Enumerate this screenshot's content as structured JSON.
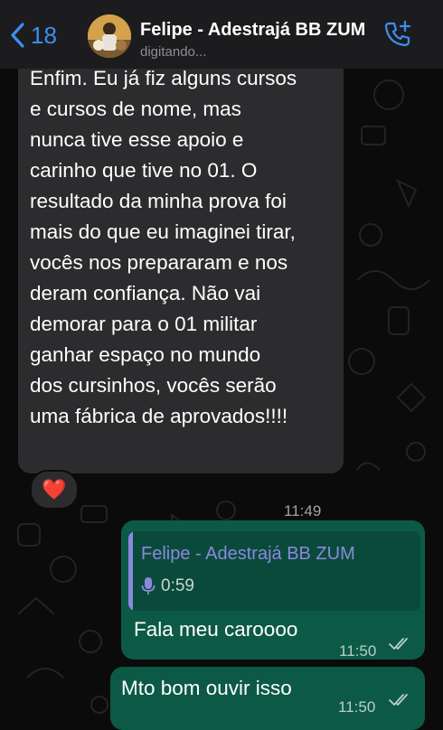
{
  "header": {
    "back_count": "18",
    "contact_name": "Felipe - Adestrajá BB ZUM",
    "status": "digitando..."
  },
  "messages": [
    {
      "direction": "incoming",
      "text": "Enfim. Eu já fiz alguns cursos\ne cursos de nome, mas\nnunca tive esse apoio e\ncarinho que tive no 01. O\nresultado da minha prova foi\nmais do que eu imaginei tirar,\nvocês nos prepararam e nos\nderam confiança. Não vai\ndemorar para o 01 militar\nganhar espaço no mundo\ndos cursinhos, vocês serão\numa fábrica de aprovados!!!!",
      "time": "11:49",
      "reaction": "❤️"
    },
    {
      "direction": "outgoing",
      "quote": {
        "author": "Felipe - Adestrajá BB ZUM",
        "audio_duration": "0:59"
      },
      "text": "Fala meu caroooo",
      "time": "11:50",
      "status": "read"
    },
    {
      "direction": "outgoing",
      "text": "Mto bom ouvir isso",
      "time": "11:50",
      "status": "read"
    }
  ],
  "colors": {
    "accent": "#3b8ff2",
    "incoming_bubble": "#2c2c2e",
    "outgoing_bubble": "#0c5a46",
    "quote_author": "#8b88e0"
  }
}
